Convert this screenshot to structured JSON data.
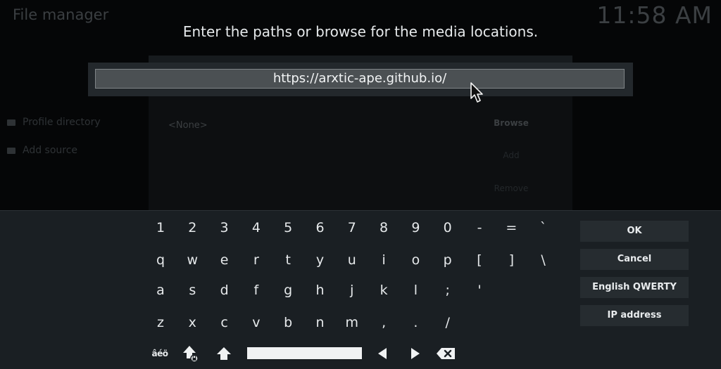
{
  "background": {
    "title": "File manager",
    "clock": "11:58 AM",
    "sidebar": [
      "Profile directory",
      "Add source"
    ],
    "source_list": {
      "empty_item": "<None>"
    },
    "buttons": [
      "Browse",
      "Add",
      "Remove"
    ]
  },
  "dialog": {
    "prompt": "Enter the paths or browse for the media locations.",
    "path_value": "https://arxtic-ape.github.io/"
  },
  "keyboard": {
    "rows": [
      [
        "1",
        "2",
        "3",
        "4",
        "5",
        "6",
        "7",
        "8",
        "9",
        "0",
        "-",
        "=",
        "`"
      ],
      [
        "q",
        "w",
        "e",
        "r",
        "t",
        "y",
        "u",
        "i",
        "o",
        "p",
        "[",
        "]",
        "\\"
      ],
      [
        "a",
        "s",
        "d",
        "f",
        "g",
        "h",
        "j",
        "k",
        "l",
        ";",
        "'"
      ],
      [
        "z",
        "x",
        "c",
        "v",
        "b",
        "n",
        "m",
        ",",
        ".",
        "/"
      ]
    ],
    "accent_label": "âéö",
    "side_buttons": [
      "OK",
      "Cancel",
      "English QWERTY",
      "IP address"
    ]
  },
  "colors": {
    "background": "#050607",
    "keyboard_bg": "#1a1f23",
    "button_bg": "#262c30",
    "input_bg": "#4b5053",
    "text": "#e8ecee"
  }
}
